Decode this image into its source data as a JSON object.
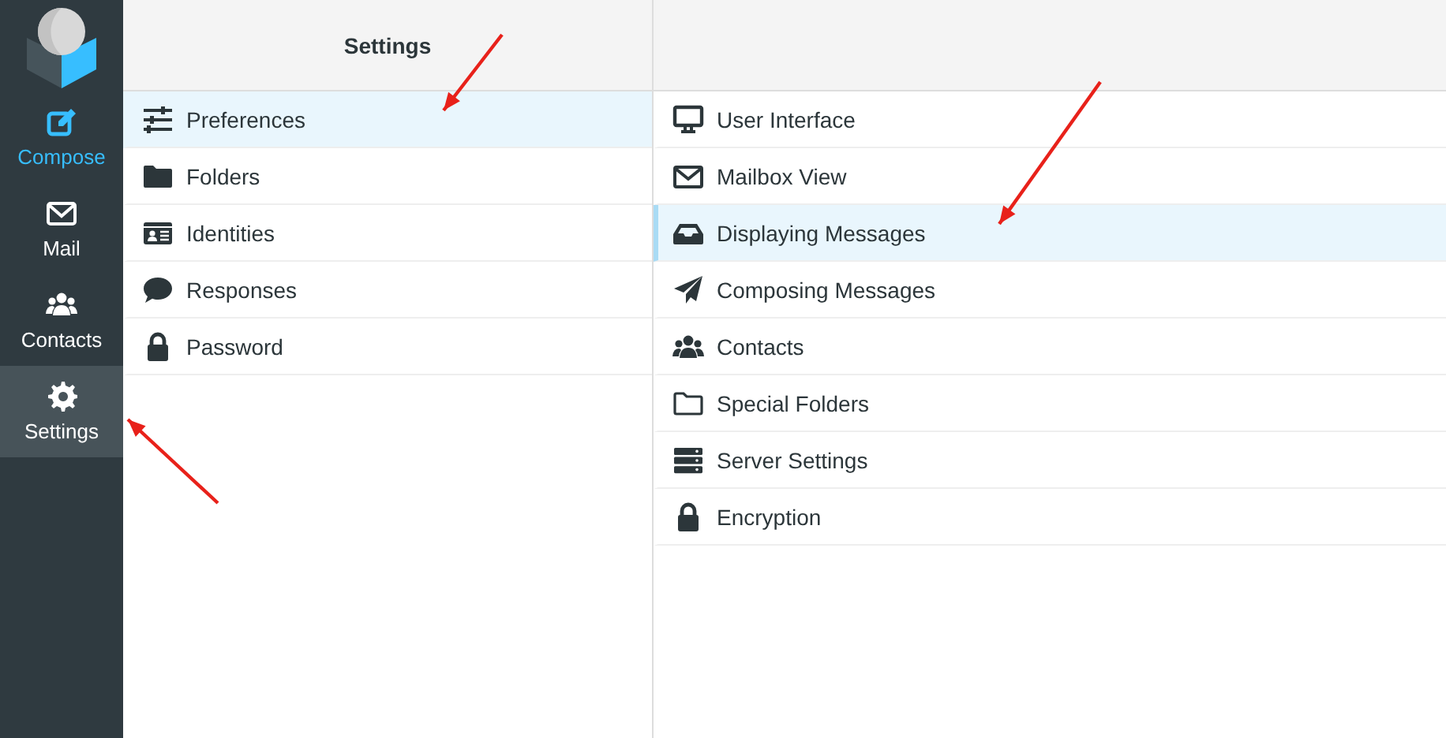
{
  "nav": [
    {
      "label": "Compose",
      "kind": "action",
      "selected": false
    },
    {
      "label": "Mail",
      "kind": "link",
      "selected": false
    },
    {
      "label": "Contacts",
      "kind": "link",
      "selected": false
    },
    {
      "label": "Settings",
      "kind": "link",
      "selected": true
    }
  ],
  "sections": {
    "title": "Settings",
    "items": [
      {
        "label": "Preferences",
        "selected": true
      },
      {
        "label": "Folders",
        "selected": false
      },
      {
        "label": "Identities",
        "selected": false
      },
      {
        "label": "Responses",
        "selected": false
      },
      {
        "label": "Password",
        "selected": false
      }
    ]
  },
  "preferences": {
    "items": [
      {
        "label": "User Interface",
        "selected": false
      },
      {
        "label": "Mailbox View",
        "selected": false
      },
      {
        "label": "Displaying Messages",
        "selected": true
      },
      {
        "label": "Composing Messages",
        "selected": false
      },
      {
        "label": "Contacts",
        "selected": false
      },
      {
        "label": "Special Folders",
        "selected": false
      },
      {
        "label": "Server Settings",
        "selected": false
      },
      {
        "label": "Encryption",
        "selected": false
      }
    ]
  }
}
